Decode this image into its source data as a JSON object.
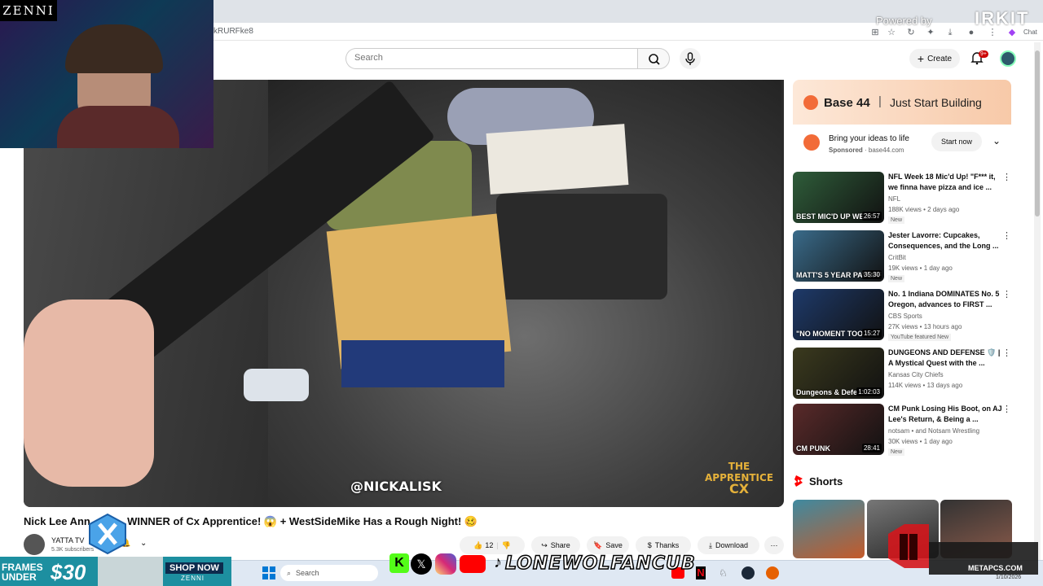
{
  "browser": {
    "url_fragment": "kRURFke8",
    "chat_label": "Chat"
  },
  "header": {
    "search_placeholder": "Search",
    "create_label": "Create",
    "notification_count": "9+"
  },
  "video": {
    "overlay_handle": "@NICKALISK",
    "overlay_logo_line1": "THE",
    "overlay_logo_line2": "APPRENTICE",
    "overlay_logo_line3": "CX",
    "title_visible_start": "Nick Lee Ann",
    "title_visible_end": "WINNER of Cx Apprentice! 😱 + WestSideMike Has a Rough Night! 🥴",
    "channel_name": "YATTA TV",
    "channel_subs": "5.3K subscribers",
    "like_count": "12",
    "share_label": "Share",
    "save_label": "Save",
    "thanks_label": "Thanks",
    "download_label": "Download"
  },
  "ad": {
    "brand": "Base 44",
    "tagline": "Just Start Building",
    "headline": "Bring your ideas to life",
    "sponsored": "Sponsored",
    "domain": "base44.com",
    "cta": "Start now"
  },
  "recommendations": [
    {
      "title": "NFL Week 18 Mic'd Up! \"F*** it, we finna have pizza and ice ...",
      "channel": "NFL",
      "meta": "188K views • 2 days ago",
      "badge": "New",
      "duration": "26:57",
      "thumb_text": "BEST MIC'D UP WE...",
      "thumb_color": "#2f5d3a"
    },
    {
      "title": "Jester Lavorre: Cupcakes, Consequences, and the Long ...",
      "channel": "CritBit",
      "meta": "19K views • 1 day ago",
      "badge": "New",
      "duration": "35:30",
      "thumb_text": "MATT'S 5 YEAR PAYOFF",
      "thumb_color": "#3a6b8a"
    },
    {
      "title": "No. 1 Indiana DOMINATES No. 5 Oregon, advances to FIRST ...",
      "channel": "CBS Sports",
      "meta": "27K views • 13 hours ago",
      "badge": "YouTube featured   New",
      "duration": "15:27",
      "thumb_text": "\"NO MOMENT TOO",
      "thumb_color": "#1e3a6a"
    },
    {
      "title": "DUNGEONS AND DEFENSE 🛡️ | A Mystical Quest with the ...",
      "channel": "Kansas City Chiefs",
      "meta": "114K views • 13 days ago",
      "badge": "",
      "duration": "1:02:03",
      "thumb_text": "Dungeons & Defe",
      "thumb_color": "#3b3a1e"
    },
    {
      "title": "CM Punk Losing His Boot, on AJ Lee's Return, & Being a ...",
      "channel": "notsam • and Notsam Wrestling",
      "meta": "30K views • 1 day ago",
      "badge": "New",
      "duration": "28:41",
      "thumb_text": "CM PUNK",
      "thumb_color": "#5a2a2a"
    }
  ],
  "shorts": {
    "heading": "Shorts"
  },
  "overlays": {
    "zenni_top": "ZENNI",
    "powered_by": "Powered by",
    "brand_right": "IRKIT",
    "frames_line1": "FRAMES",
    "frames_line2": "UNDER",
    "frames_price": "$30",
    "shop_now": "SHOP NOW",
    "zenni_small": "ZENNI",
    "social_handle": "LONEWOLFANCUB",
    "metapcs": "METAPCS.COM"
  },
  "taskbar": {
    "search_label": "Search",
    "date": "1/10/2026"
  },
  "colors": {
    "youtube_red": "#ff0000",
    "ad_accent": "#f26b38",
    "zenni_teal": "#1d8fa0"
  }
}
